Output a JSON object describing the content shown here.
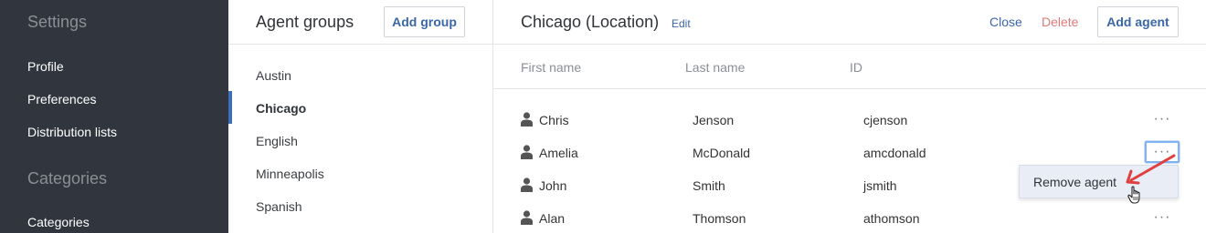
{
  "sidebar": {
    "settings_heading": "Settings",
    "settings_items": [
      "Profile",
      "Preferences",
      "Distribution lists"
    ],
    "categories_heading": "Categories",
    "categories_items": [
      "Categories"
    ]
  },
  "groups": {
    "title": "Agent groups",
    "add_group_label": "Add group",
    "items": [
      "Austin",
      "Chicago",
      "English",
      "Minneapolis",
      "Spanish"
    ],
    "selected": "Chicago"
  },
  "detail": {
    "title": "Chicago (Location)",
    "edit_label": "Edit",
    "close_label": "Close",
    "delete_label": "Delete",
    "add_agent_label": "Add agent",
    "columns": [
      "First name",
      "Last name",
      "ID"
    ],
    "rows": [
      {
        "first": "Chris",
        "last": "Jenson",
        "id": "cjenson",
        "more": "···"
      },
      {
        "first": "Amelia",
        "last": "McDonald",
        "id": "amcdonald",
        "more": "···"
      },
      {
        "first": "John",
        "last": "Smith",
        "id": "jsmith",
        "more": "···"
      },
      {
        "first": "Alan",
        "last": "Thomson",
        "id": "athomson",
        "more": "···"
      }
    ],
    "menu": {
      "remove_label": "Remove agent"
    }
  },
  "colors": {
    "sidebar_bg": "#31363e",
    "link_blue": "#3a66a8",
    "delete_red": "#e07a7a",
    "active_bar": "#3f6fb5",
    "annotation_arrow": "#e0403f"
  },
  "icons": [
    "person-icon",
    "more-options-icon",
    "annotation-arrow",
    "hand-cursor-icon"
  ]
}
